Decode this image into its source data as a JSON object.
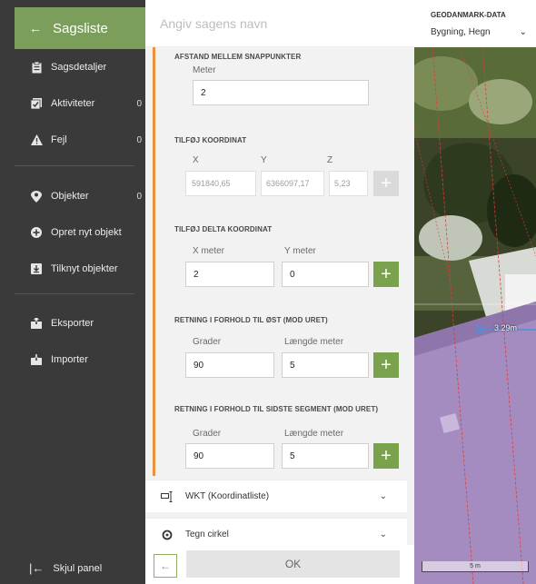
{
  "sidebar": {
    "back_arrow": "←",
    "title": "Sagsliste",
    "items": [
      {
        "label": "Sagsdetaljer",
        "count": ""
      },
      {
        "label": "Aktiviteter",
        "count": "0"
      },
      {
        "label": "Fejl",
        "count": "0"
      },
      {
        "label": "Objekter",
        "count": "0"
      },
      {
        "label": "Opret nyt objekt",
        "count": ""
      },
      {
        "label": "Tilknyt objekter",
        "count": ""
      },
      {
        "label": "Eksporter",
        "count": ""
      },
      {
        "label": "Importer",
        "count": ""
      }
    ],
    "footer": {
      "icon": "|←",
      "label": "Skjul panel"
    }
  },
  "main": {
    "name_placeholder": "Angiv sagens navn",
    "snap": {
      "heading": "AFSTAND MELLEM SNAPPUNKTER",
      "label": "Meter",
      "value": "2"
    },
    "coord": {
      "heading": "TILFØJ KOORDINAT",
      "x_label": "X",
      "y_label": "Y",
      "z_label": "Z",
      "x_placeholder": "591840,65",
      "y_placeholder": "6366097,17",
      "z_placeholder": "5,23"
    },
    "delta": {
      "heading": "TILFØJ DELTA KOORDINAT",
      "x_label": "X meter",
      "y_label": "Y meter",
      "x_value": "2",
      "y_value": "0"
    },
    "east": {
      "heading": "RETNING I FORHOLD TIL ØST (MOD URET)",
      "deg_label": "Grader",
      "len_label": "Længde meter",
      "deg_value": "90",
      "len_value": "5"
    },
    "last": {
      "heading": "RETNING I FORHOLD TIL SIDSTE SEGMENT (MOD URET)",
      "deg_label": "Grader",
      "len_label": "Længde meter",
      "deg_value": "90",
      "len_value": "5"
    },
    "plus": "+",
    "accordions": [
      {
        "label": "WKT (Koordinatliste)",
        "chevron": "⌄"
      },
      {
        "label": "Tegn cirkel",
        "chevron": "⌄"
      }
    ],
    "back_button": "←",
    "ok_button": "OK"
  },
  "geodata": {
    "title": "GEODANMARK-DATA",
    "selected": "Bygning, Hegn",
    "chevron": "⌄"
  },
  "map": {
    "distance_label": "3.29m",
    "scale_label": "5 m"
  },
  "colors": {
    "sidebar_bg": "#3a3a3a",
    "accent_green": "#7aa24c",
    "accent_orange": "#e8923b",
    "building_purple": "#a58cc0"
  }
}
